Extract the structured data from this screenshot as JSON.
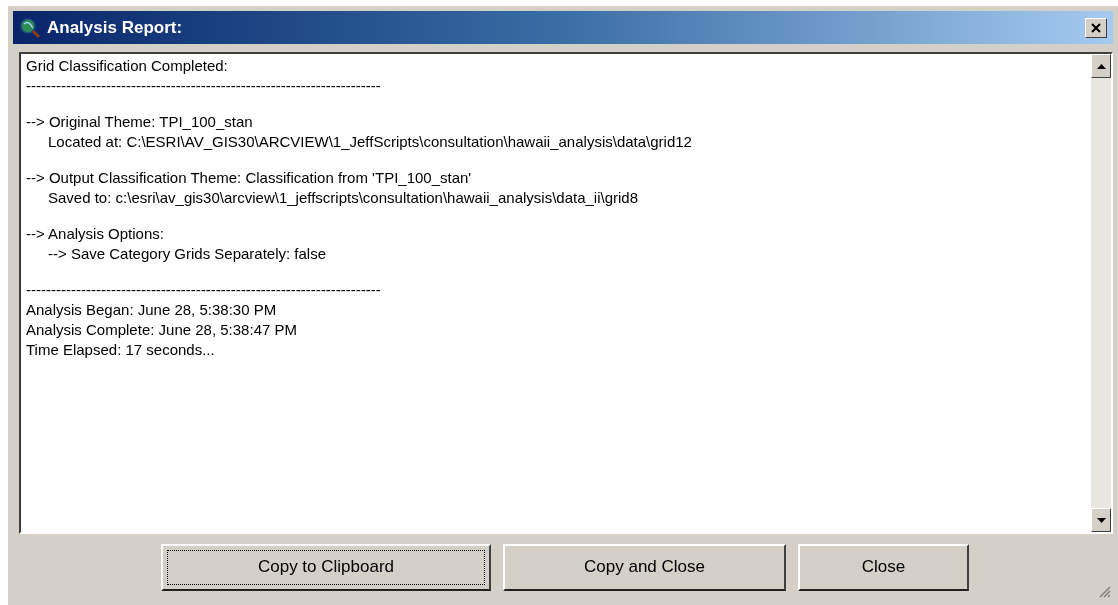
{
  "window": {
    "title": "Analysis Report:"
  },
  "report": {
    "blocks": [
      [
        {
          "text": "Grid Classification Completed:"
        },
        {
          "text": "-----------------------------------------------------------------------"
        }
      ],
      [
        {
          "text": "--> Original Theme: TPI_100_stan",
          "children": [
            {
              "text": "Located at: C:\\ESRI\\AV_GIS30\\ARCVIEW\\1_JeffScripts\\consultation\\hawaii_analysis\\data\\grid12"
            }
          ]
        }
      ],
      [
        {
          "text": "--> Output Classification Theme: Classification from 'TPI_100_stan'",
          "children": [
            {
              "text": "Saved to: c:\\esri\\av_gis30\\arcview\\1_jeffscripts\\consultation\\hawaii_analysis\\data_ii\\grid8"
            }
          ]
        }
      ],
      [
        {
          "text": "--> Analysis Options:",
          "children": [
            {
              "text": "--> Save Category Grids Separately: false"
            }
          ]
        }
      ],
      [
        {
          "text": "-----------------------------------------------------------------------"
        },
        {
          "text": "Analysis Began: June 28, 5:38:30 PM"
        },
        {
          "text": "Analysis Complete: June 28, 5:38:47 PM"
        },
        {
          "text": "Time Elapsed: 17 seconds..."
        }
      ]
    ]
  },
  "buttons": [
    {
      "label": "Copy to Clipboard",
      "focused": true
    },
    {
      "label": "Copy and Close",
      "focused": false
    },
    {
      "label": "Close",
      "focused": false
    }
  ]
}
